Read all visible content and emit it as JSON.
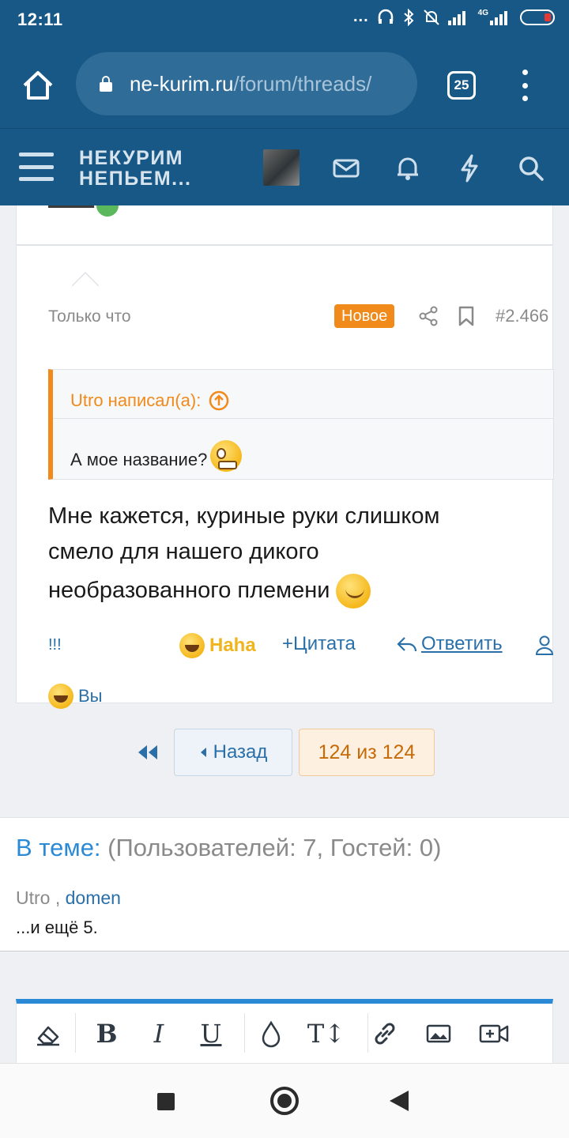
{
  "status_bar": {
    "time": "12:11",
    "dots": "...",
    "network": "4G"
  },
  "browser": {
    "url_host": "ne-kurim.ru",
    "url_path": "/forum/threads/",
    "tab_count": "25"
  },
  "site_header": {
    "logo_line1": "НЕКУРИМ",
    "logo_line2": "НЕПЬЕМ..."
  },
  "post": {
    "time": "Только что",
    "badge": "Новое",
    "number": "#2.466",
    "quote_author": "Utro написал(а):",
    "quote_text": "А мое название?",
    "text_line1": "Мне кажется, куриные руки слишком",
    "text_line2": "смело для нашего дикого",
    "text_line3": "необразованного племени",
    "actions": {
      "exclaim": "!!!",
      "haha": "Haha",
      "quote": "+Цитата",
      "reply": "Ответить"
    },
    "reactions_label": "Вы"
  },
  "pager": {
    "back": "Назад",
    "count": "124 из 124"
  },
  "online": {
    "lead": "В теме:",
    "stats": "(Пользователей: 7, Гостей: 0)",
    "user1": "Utro",
    "separator": " , ",
    "user2": "domen",
    "more": "...и ещё 5."
  },
  "editor": {
    "tools": [
      "eraser-icon",
      "bold-icon",
      "italic-icon",
      "underline-icon",
      "color-icon",
      "text-size-icon",
      "link-icon",
      "image-icon",
      "video-icon"
    ],
    "bold": "B",
    "italic": "I",
    "underline": "U",
    "text_size": "T↕"
  },
  "colors": {
    "primary": "#185886",
    "accent": "#f08a1a",
    "link": "#2a6fa8"
  }
}
